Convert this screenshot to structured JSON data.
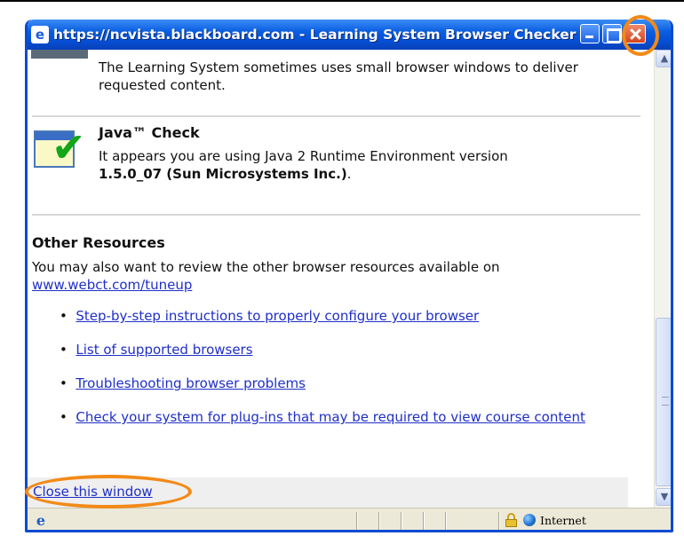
{
  "window": {
    "title": "https://ncvista.blackboard.com - Learning System Browser Checker - Mi...",
    "icon": "ie-page-icon"
  },
  "content": {
    "popup_note": "The Learning System sometimes uses small browser windows to deliver requested content.",
    "java": {
      "heading": "Java™ Check",
      "text_before": "It appears you are using Java 2 Runtime Environment version",
      "version": "1.5.0_07 (Sun Microsystems Inc.)",
      "text_after": "."
    },
    "resources": {
      "heading": "Other Resources",
      "intro": "You may also want to review the other browser resources available on",
      "intro_link": "www.webct.com/tuneup",
      "links": [
        "Step-by-step instructions to properly configure your browser",
        "List of supported browsers",
        "Troubleshooting browser problems",
        "Check your system for plug-ins that may be required to view course content"
      ]
    },
    "close_link": "Close this window"
  },
  "statusbar": {
    "zone": "Internet",
    "icons": [
      "ie-icon",
      "lock-icon",
      "internet-zone-icon"
    ]
  },
  "colors": {
    "titlebar": "#0a5ee0",
    "link": "#1f2fc8",
    "highlight": "#f28a18"
  }
}
